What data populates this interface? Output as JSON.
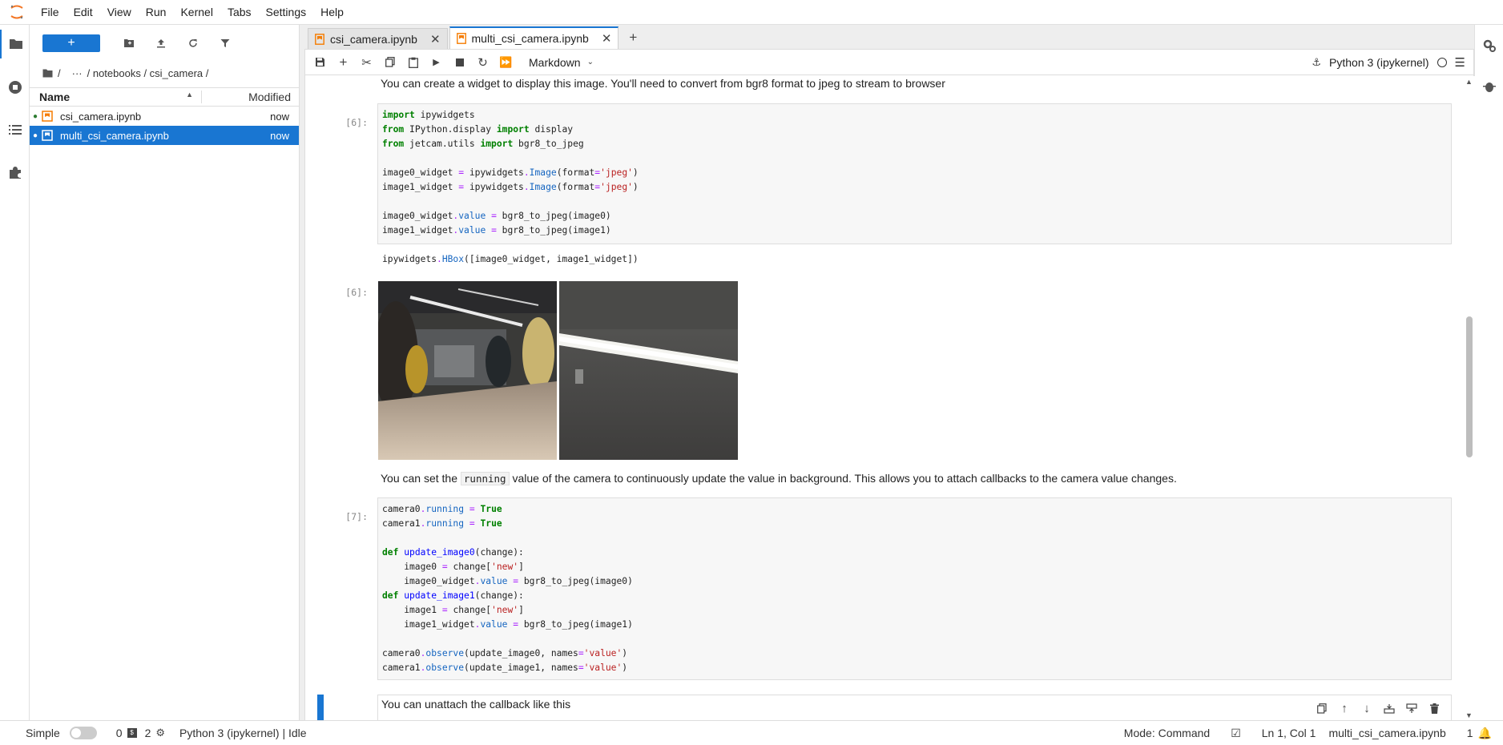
{
  "menubar": {
    "items": [
      "File",
      "Edit",
      "View",
      "Run",
      "Kernel",
      "Tabs",
      "Settings",
      "Help"
    ]
  },
  "filebrowser": {
    "new_label": "+",
    "breadcrumb": [
      "/",
      "···",
      "/ notebooks / csi_camera /"
    ],
    "header_name": "Name",
    "header_modified": "Modified",
    "files": [
      {
        "name": "csi_camera.ipynb",
        "modified": "now",
        "selected": false
      },
      {
        "name": "multi_csi_camera.ipynb",
        "modified": "now",
        "selected": true
      }
    ]
  },
  "tabs": [
    {
      "label": "csi_camera.ipynb",
      "active": false
    },
    {
      "label": "multi_csi_camera.ipynb",
      "active": true
    }
  ],
  "notebook_toolbar": {
    "cell_type": "Markdown",
    "kernel_name": "Python 3 (ipykernel)"
  },
  "cells": {
    "md1": "You can create a widget to display this image. You'll need to convert from bgr8 format to jpeg to stream to browser",
    "prompt_in6": "[6]:",
    "prompt_out6": "[6]:",
    "md2_before": "You can set the",
    "md2_code": "running",
    "md2_after": "value of the camera to continuously update the value in background. This allows you to attach callbacks to the camera value changes.",
    "prompt_in7": "[7]:",
    "md3": "You can unattach the callback like this"
  },
  "statusbar": {
    "mode_label": "Simple",
    "terminals_count": "0",
    "kernels_count": "2",
    "kernel_status": "Python 3 (ipykernel) | Idle",
    "mode": "Mode: Command",
    "cursor": "Ln 1, Col 1",
    "filename": "multi_csi_camera.ipynb",
    "notifications": "1"
  },
  "colors": {
    "accent": "#1976d2",
    "notebook_icon": "#f57c00"
  }
}
